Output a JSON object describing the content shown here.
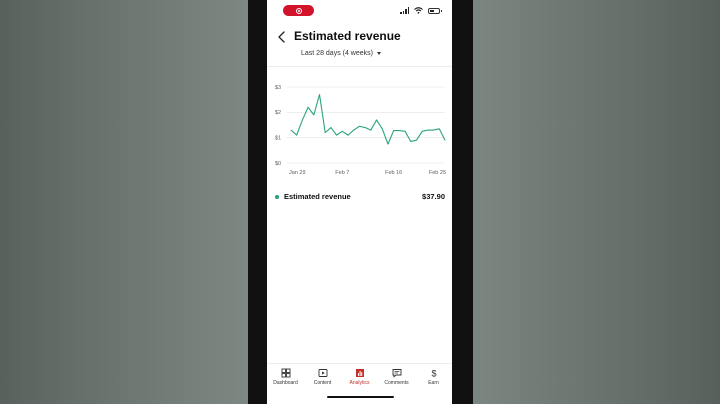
{
  "colors": {
    "accent": "#c4302b",
    "line": "#2ba57a",
    "record": "#d3122b"
  },
  "status_bar": {
    "record_icon": "screen-record-icon",
    "icons": [
      "cellular-signal-icon",
      "wifi-icon",
      "battery-icon"
    ]
  },
  "header": {
    "back_icon": "chevron-left-icon",
    "title": "Estimated revenue",
    "range_label": "Last 28 days (4 weeks)",
    "range_icon": "caret-down-icon"
  },
  "chart_data": {
    "type": "line",
    "title": "",
    "xlabel": "",
    "ylabel": "",
    "ylim": [
      0,
      3
    ],
    "y_ticks": [
      {
        "value": 3,
        "label": "$3"
      },
      {
        "value": 2,
        "label": "$2"
      },
      {
        "value": 1,
        "label": "$1"
      },
      {
        "value": 0,
        "label": "$0"
      }
    ],
    "x_ticks": [
      {
        "value": 1,
        "label": "Jan 29"
      },
      {
        "value": 10,
        "label": "Feb 7"
      },
      {
        "value": 19,
        "label": "Feb 16"
      },
      {
        "value": 28,
        "label": "Feb 25"
      }
    ],
    "xlim": [
      1,
      28
    ],
    "grid": true,
    "series": [
      {
        "name": "",
        "color": "#2ba57a",
        "x": [
          1,
          2,
          3,
          4,
          5,
          6,
          7,
          8,
          9,
          10,
          11,
          12,
          13,
          14,
          15,
          16,
          17,
          18,
          19,
          20,
          21,
          22,
          23,
          24,
          25,
          26,
          27,
          28
        ],
        "values": [
          1.3,
          1.1,
          1.7,
          2.2,
          1.9,
          2.7,
          1.2,
          1.4,
          1.1,
          1.25,
          1.1,
          1.3,
          1.45,
          1.4,
          1.3,
          1.7,
          1.35,
          0.75,
          1.28,
          1.28,
          1.25,
          0.85,
          0.9,
          1.25,
          1.3,
          1.3,
          1.35,
          0.9
        ]
      }
    ]
  },
  "metric": {
    "label": "Estimated revenue",
    "value": "$37.90"
  },
  "bottom_nav": {
    "items": [
      {
        "label": "Dashboard",
        "icon": "dashboard-icon",
        "active": false
      },
      {
        "label": "Content",
        "icon": "content-icon",
        "active": false
      },
      {
        "label": "Analytics",
        "icon": "analytics-icon",
        "active": true
      },
      {
        "label": "Comments",
        "icon": "comments-icon",
        "active": false
      },
      {
        "label": "Earn",
        "icon": "dollar-icon",
        "active": false
      }
    ]
  }
}
